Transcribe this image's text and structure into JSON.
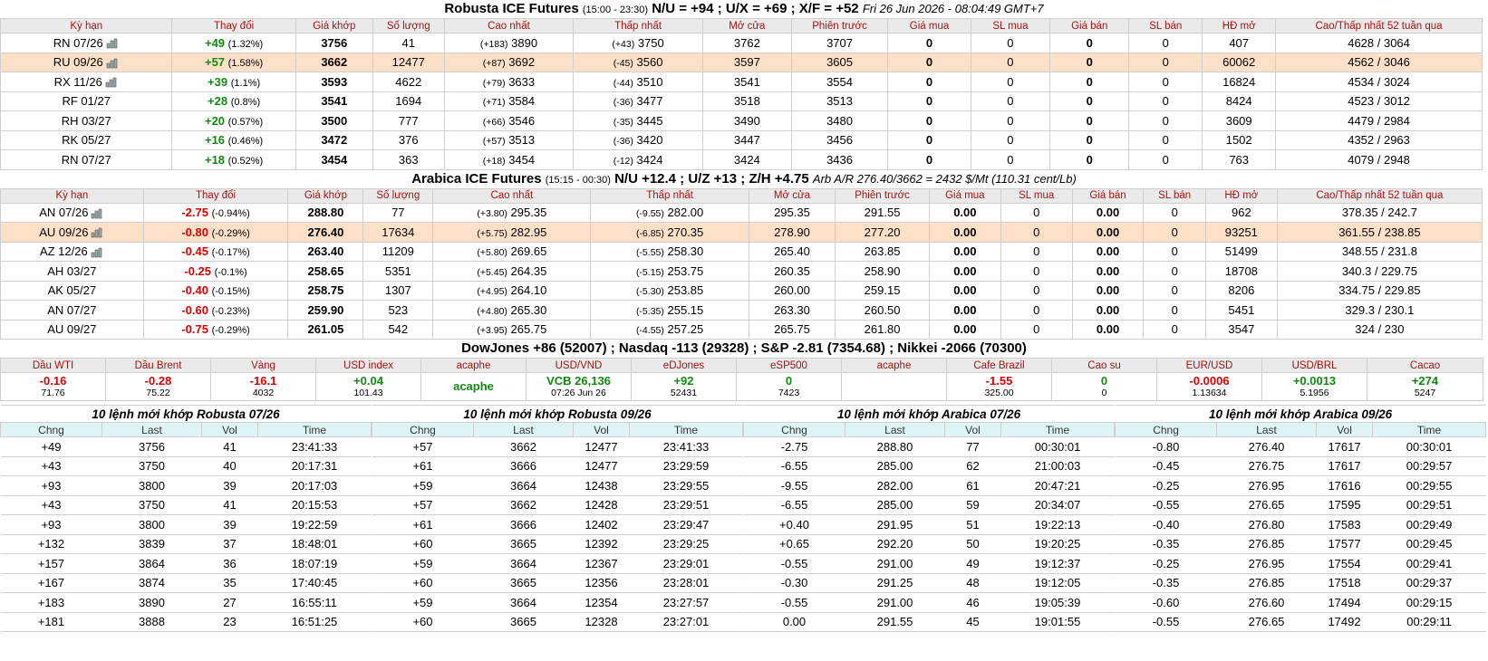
{
  "robusta": {
    "title": "Robusta ICE Futures",
    "hours": "(15:00 - 23:30)",
    "spreads": "N/U = +94 ; U/X = +69 ; X/F = +52",
    "timestamp": "Fri 26 Jun 2026 - 08:04:49 GMT+7",
    "headers": [
      "Kỳ hạn",
      "Thay đổi",
      "Giá khớp",
      "Số lượng",
      "Cao nhất",
      "Thấp nhất",
      "Mở cửa",
      "Phiên trước",
      "Giá mua",
      "SL mua",
      "Giá bán",
      "SL bán",
      "HĐ mở",
      "Cao/Thấp nhất 52 tuần qua"
    ],
    "rows": [
      {
        "term": "RN 07/26",
        "chart": true,
        "chg": "+49",
        "pct": "(1.32%)",
        "dir": "up",
        "last": "3756",
        "vol": "41",
        "high_d": "(+183)",
        "high": "3890",
        "low_d": "(+43)",
        "low": "3750",
        "open": "3762",
        "prev": "3707",
        "bid": "0",
        "bidq": "0",
        "ask": "0",
        "askq": "0",
        "oi": "407",
        "hl52": "4628 / 3064",
        "hl": false
      },
      {
        "term": "RU 09/26",
        "chart": true,
        "chg": "+57",
        "pct": "(1.58%)",
        "dir": "up",
        "last": "3662",
        "vol": "12477",
        "high_d": "(+87)",
        "high": "3692",
        "low_d": "(-45)",
        "low": "3560",
        "open": "3597",
        "prev": "3605",
        "bid": "0",
        "bidq": "0",
        "ask": "0",
        "askq": "0",
        "oi": "60062",
        "hl52": "4562 / 3046",
        "hl": true
      },
      {
        "term": "RX 11/26",
        "chart": true,
        "chg": "+39",
        "pct": "(1.1%)",
        "dir": "up",
        "last": "3593",
        "vol": "4622",
        "high_d": "(+79)",
        "high": "3633",
        "low_d": "(-44)",
        "low": "3510",
        "open": "3541",
        "prev": "3554",
        "bid": "0",
        "bidq": "0",
        "ask": "0",
        "askq": "0",
        "oi": "16824",
        "hl52": "4534 / 3024",
        "hl": false
      },
      {
        "term": "RF 01/27",
        "chart": false,
        "chg": "+28",
        "pct": "(0.8%)",
        "dir": "up",
        "last": "3541",
        "vol": "1694",
        "high_d": "(+71)",
        "high": "3584",
        "low_d": "(-36)",
        "low": "3477",
        "open": "3518",
        "prev": "3513",
        "bid": "0",
        "bidq": "0",
        "ask": "0",
        "askq": "0",
        "oi": "8424",
        "hl52": "4523 / 3012",
        "hl": false
      },
      {
        "term": "RH 03/27",
        "chart": false,
        "chg": "+20",
        "pct": "(0.57%)",
        "dir": "up",
        "last": "3500",
        "vol": "777",
        "high_d": "(+66)",
        "high": "3546",
        "low_d": "(-35)",
        "low": "3445",
        "open": "3490",
        "prev": "3480",
        "bid": "0",
        "bidq": "0",
        "ask": "0",
        "askq": "0",
        "oi": "3609",
        "hl52": "4479 / 2984",
        "hl": false
      },
      {
        "term": "RK 05/27",
        "chart": false,
        "chg": "+16",
        "pct": "(0.46%)",
        "dir": "up",
        "last": "3472",
        "vol": "376",
        "high_d": "(+57)",
        "high": "3513",
        "low_d": "(-36)",
        "low": "3420",
        "open": "3447",
        "prev": "3456",
        "bid": "0",
        "bidq": "0",
        "ask": "0",
        "askq": "0",
        "oi": "1502",
        "hl52": "4352 / 2963",
        "hl": false
      },
      {
        "term": "RN 07/27",
        "chart": false,
        "chg": "+18",
        "pct": "(0.52%)",
        "dir": "up",
        "last": "3454",
        "vol": "363",
        "high_d": "(+18)",
        "high": "3454",
        "low_d": "(-12)",
        "low": "3424",
        "open": "3424",
        "prev": "3436",
        "bid": "0",
        "bidq": "0",
        "ask": "0",
        "askq": "0",
        "oi": "763",
        "hl52": "4079 / 2948",
        "hl": false
      }
    ]
  },
  "arabica": {
    "title": "Arabica ICE Futures",
    "hours": "(15:15 - 00:30)",
    "spreads": "N/U +12.4 ; U/Z +13 ; Z/H +4.75",
    "arb": "Arb A/R 276.40/3662 = 2432 $/Mt (110.31 cent/Lb)",
    "headers": [
      "Kỳ hạn",
      "Thay đổi",
      "Giá khớp",
      "Số lượng",
      "Cao nhất",
      "Thấp nhất",
      "Mở cửa",
      "Phiên trước",
      "Giá mua",
      "SL mua",
      "Giá bán",
      "SL bán",
      "HĐ mở",
      "Cao/Thấp nhất 52 tuần qua"
    ],
    "rows": [
      {
        "term": "AN 07/26",
        "chart": true,
        "chg": "-2.75",
        "pct": "(-0.94%)",
        "dir": "dn",
        "last": "288.80",
        "vol": "77",
        "high_d": "(+3.80)",
        "high": "295.35",
        "low_d": "(-9.55)",
        "low": "282.00",
        "open": "295.35",
        "prev": "291.55",
        "bid": "0.00",
        "bidq": "0",
        "ask": "0.00",
        "askq": "0",
        "oi": "962",
        "hl52": "378.35 / 242.7",
        "hl": false
      },
      {
        "term": "AU 09/26",
        "chart": true,
        "chg": "-0.80",
        "pct": "(-0.29%)",
        "dir": "dn",
        "last": "276.40",
        "vol": "17634",
        "high_d": "(+5.75)",
        "high": "282.95",
        "low_d": "(-6.85)",
        "low": "270.35",
        "open": "278.90",
        "prev": "277.20",
        "bid": "0.00",
        "bidq": "0",
        "ask": "0.00",
        "askq": "0",
        "oi": "93251",
        "hl52": "361.55 / 238.85",
        "hl": true
      },
      {
        "term": "AZ 12/26",
        "chart": true,
        "chg": "-0.45",
        "pct": "(-0.17%)",
        "dir": "dn",
        "last": "263.40",
        "vol": "11209",
        "high_d": "(+5.80)",
        "high": "269.65",
        "low_d": "(-5.55)",
        "low": "258.30",
        "open": "265.40",
        "prev": "263.85",
        "bid": "0.00",
        "bidq": "0",
        "ask": "0.00",
        "askq": "0",
        "oi": "51499",
        "hl52": "348.55 / 231.8",
        "hl": false
      },
      {
        "term": "AH 03/27",
        "chart": false,
        "chg": "-0.25",
        "pct": "(-0.1%)",
        "dir": "dn",
        "last": "258.65",
        "vol": "5351",
        "high_d": "(+5.45)",
        "high": "264.35",
        "low_d": "(-5.15)",
        "low": "253.75",
        "open": "260.35",
        "prev": "258.90",
        "bid": "0.00",
        "bidq": "0",
        "ask": "0.00",
        "askq": "0",
        "oi": "18708",
        "hl52": "340.3 / 229.75",
        "hl": false
      },
      {
        "term": "AK 05/27",
        "chart": false,
        "chg": "-0.40",
        "pct": "(-0.15%)",
        "dir": "dn",
        "last": "258.75",
        "vol": "1307",
        "high_d": "(+4.95)",
        "high": "264.10",
        "low_d": "(-5.30)",
        "low": "253.85",
        "open": "260.00",
        "prev": "259.15",
        "bid": "0.00",
        "bidq": "0",
        "ask": "0.00",
        "askq": "0",
        "oi": "8206",
        "hl52": "334.75 / 229.85",
        "hl": false
      },
      {
        "term": "AN 07/27",
        "chart": false,
        "chg": "-0.60",
        "pct": "(-0.23%)",
        "dir": "dn",
        "last": "259.90",
        "vol": "523",
        "high_d": "(+4.80)",
        "high": "265.30",
        "low_d": "(-5.35)",
        "low": "255.15",
        "open": "263.30",
        "prev": "260.50",
        "bid": "0.00",
        "bidq": "0",
        "ask": "0.00",
        "askq": "0",
        "oi": "5451",
        "hl52": "329.3 / 230.1",
        "hl": false
      },
      {
        "term": "AU 09/27",
        "chart": false,
        "chg": "-0.75",
        "pct": "(-0.29%)",
        "dir": "dn",
        "last": "261.05",
        "vol": "542",
        "high_d": "(+3.95)",
        "high": "265.75",
        "low_d": "(-4.55)",
        "low": "257.25",
        "open": "265.75",
        "prev": "261.80",
        "bid": "0.00",
        "bidq": "0",
        "ask": "0.00",
        "askq": "0",
        "oi": "3547",
        "hl52": "324 / 230",
        "hl": false
      }
    ]
  },
  "indices_line": "DowJones +86 (52007) ; Nasdaq -113 (29328) ; S&P -2.81 (7354.68) ; Nikkei -2066 (70300)",
  "markets": [
    {
      "name": "Dầu WTI",
      "val": "-0.16",
      "sub": "71.76",
      "color": "red"
    },
    {
      "name": "Dầu Brent",
      "val": "-0.28",
      "sub": "75.22",
      "color": "red"
    },
    {
      "name": "Vàng",
      "val": "-16.1",
      "sub": "4032",
      "color": "red"
    },
    {
      "name": "USD index",
      "val": "+0.04",
      "sub": "101.43",
      "color": "grn"
    },
    {
      "name": "acaphe",
      "val": "acaphe",
      "sub": "",
      "color": "grn"
    },
    {
      "name": "USD/VND",
      "val": "VCB 26,136",
      "sub": "07:26 Jun 26",
      "color": "grn"
    },
    {
      "name": "eDJones",
      "val": "+92",
      "sub": "52431",
      "color": "grn"
    },
    {
      "name": "eSP500",
      "val": "0",
      "sub": "7423",
      "color": "grn"
    },
    {
      "name": "acaphe",
      "val": "",
      "sub": "",
      "color": "grn"
    },
    {
      "name": "Cafe Brazil",
      "val": "-1.55",
      "sub": "325.00",
      "color": "red"
    },
    {
      "name": "Cao su",
      "val": "0",
      "sub": "0",
      "color": "grn"
    },
    {
      "name": "EUR/USD",
      "val": "-0.0006",
      "sub": "1.13634",
      "color": "red"
    },
    {
      "name": "USD/BRL",
      "val": "+0.0013",
      "sub": "5.1956",
      "color": "grn"
    },
    {
      "name": "Cacao",
      "val": "+274",
      "sub": "5247",
      "color": "grn"
    }
  ],
  "trades": [
    {
      "caption": "10 lệnh mới khớp Robusta 07/26",
      "headers": [
        "Chng",
        "Last",
        "Vol",
        "Time"
      ],
      "rows": [
        [
          "+49",
          "3756",
          "41",
          "23:41:33"
        ],
        [
          "+43",
          "3750",
          "40",
          "20:17:31"
        ],
        [
          "+93",
          "3800",
          "39",
          "20:17:03"
        ],
        [
          "+43",
          "3750",
          "41",
          "20:15:53"
        ],
        [
          "+93",
          "3800",
          "39",
          "19:22:59"
        ],
        [
          "+132",
          "3839",
          "37",
          "18:48:01"
        ],
        [
          "+157",
          "3864",
          "36",
          "18:07:19"
        ],
        [
          "+167",
          "3874",
          "35",
          "17:40:45"
        ],
        [
          "+183",
          "3890",
          "27",
          "16:55:11"
        ],
        [
          "+181",
          "3888",
          "23",
          "16:51:25"
        ]
      ]
    },
    {
      "caption": "10 lệnh mới khớp Robusta 09/26",
      "headers": [
        "Chng",
        "Last",
        "Vol",
        "Time"
      ],
      "rows": [
        [
          "+57",
          "3662",
          "12477",
          "23:41:33"
        ],
        [
          "+61",
          "3666",
          "12477",
          "23:29:59"
        ],
        [
          "+59",
          "3664",
          "12438",
          "23:29:55"
        ],
        [
          "+57",
          "3662",
          "12428",
          "23:29:51"
        ],
        [
          "+61",
          "3666",
          "12402",
          "23:29:47"
        ],
        [
          "+60",
          "3665",
          "12392",
          "23:29:25"
        ],
        [
          "+59",
          "3664",
          "12367",
          "23:29:01"
        ],
        [
          "+60",
          "3665",
          "12356",
          "23:28:01"
        ],
        [
          "+59",
          "3664",
          "12354",
          "23:27:57"
        ],
        [
          "+60",
          "3665",
          "12328",
          "23:27:01"
        ]
      ]
    },
    {
      "caption": "10 lệnh mới khớp Arabica 07/26",
      "headers": [
        "Chng",
        "Last",
        "Vol",
        "Time"
      ],
      "rows": [
        [
          "-2.75",
          "288.80",
          "77",
          "00:30:01"
        ],
        [
          "-6.55",
          "285.00",
          "62",
          "21:00:03"
        ],
        [
          "-9.55",
          "282.00",
          "61",
          "20:47:21"
        ],
        [
          "-6.55",
          "285.00",
          "59",
          "20:34:07"
        ],
        [
          "+0.40",
          "291.95",
          "51",
          "19:22:13"
        ],
        [
          "+0.65",
          "292.20",
          "50",
          "19:20:25"
        ],
        [
          "-0.55",
          "291.00",
          "49",
          "19:12:37"
        ],
        [
          "-0.30",
          "291.25",
          "48",
          "19:12:05"
        ],
        [
          "-0.55",
          "291.00",
          "46",
          "19:05:39"
        ],
        [
          "0.00",
          "291.55",
          "45",
          "19:01:55"
        ]
      ]
    },
    {
      "caption": "10 lệnh mới khớp Arabica 09/26",
      "headers": [
        "Chng",
        "Last",
        "Vol",
        "Time"
      ],
      "rows": [
        [
          "-0.80",
          "276.40",
          "17617",
          "00:30:01"
        ],
        [
          "-0.45",
          "276.75",
          "17617",
          "00:29:57"
        ],
        [
          "-0.25",
          "276.95",
          "17616",
          "00:29:55"
        ],
        [
          "-0.55",
          "276.65",
          "17595",
          "00:29:51"
        ],
        [
          "-0.40",
          "276.80",
          "17583",
          "00:29:49"
        ],
        [
          "-0.35",
          "276.85",
          "17577",
          "00:29:45"
        ],
        [
          "-0.25",
          "276.95",
          "17554",
          "00:29:41"
        ],
        [
          "-0.35",
          "276.85",
          "17518",
          "00:29:37"
        ],
        [
          "-0.60",
          "276.60",
          "17494",
          "00:29:15"
        ],
        [
          "-0.55",
          "276.65",
          "17492",
          "00:29:11"
        ]
      ]
    }
  ]
}
